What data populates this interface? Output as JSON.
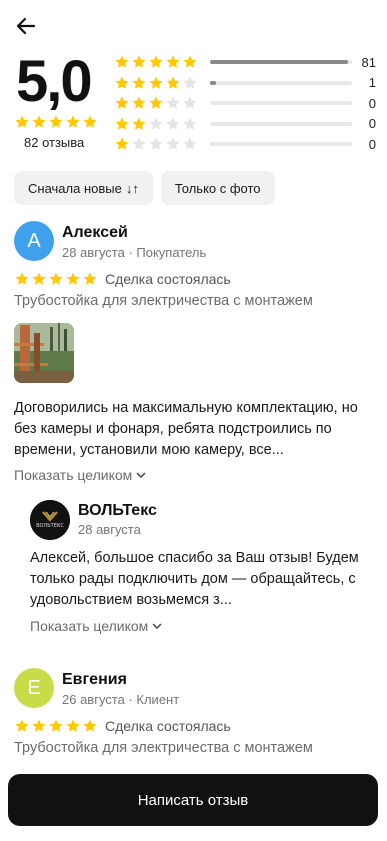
{
  "header": {
    "back_icon": "arrow-left-icon"
  },
  "summary": {
    "score": "5,0",
    "reviews_count": "82 отзыва",
    "average_rating": 5,
    "distribution": [
      {
        "stars": 5,
        "count": "81",
        "fraction": 0.97
      },
      {
        "stars": 4,
        "count": "1",
        "fraction": 0.04
      },
      {
        "stars": 3,
        "count": "0",
        "fraction": 0
      },
      {
        "stars": 2,
        "count": "0",
        "fraction": 0
      },
      {
        "stars": 1,
        "count": "0",
        "fraction": 0
      }
    ]
  },
  "filters": {
    "sort_label": "Сначала новые",
    "sort_icon": "↓↑",
    "photo_label": "Только с фото"
  },
  "reviews": [
    {
      "avatar_letter": "А",
      "avatar_color": "#3fa0ee",
      "name": "Алексей",
      "meta": "28 августа · Покупатель",
      "rating": 5,
      "deal_status": "Сделка состоялась",
      "product": "Трубостойка для электричества с монтажем",
      "text": "Договорились на максимальную комплектацию, но без камеры и фонаря, ребята подстроились по времени, установили мою камеру, все...",
      "show_more": "Показать целиком",
      "reply": {
        "name": "ВОЛЬТекс",
        "logo_text": "ВОЛЬТЕКС",
        "date": "28 августа",
        "text": "Алексей, большое спасибо за Ваш отзыв! Будем только рады подключить дом — обращайтесь, с удовольствием возьмемся з...",
        "show_more": "Показать целиком"
      }
    },
    {
      "avatar_letter": "Е",
      "avatar_color": "#c8dc4a",
      "name": "Евгения",
      "meta": "26 августа · Клиент",
      "rating": 5,
      "deal_status": "Сделка состоялась",
      "product": "Трубостойка для электричества с монтажем"
    }
  ],
  "footer": {
    "write_review": "Написать отзыв"
  },
  "colors": {
    "star_filled": "#ffc800",
    "star_empty": "#e4e4e4",
    "button_bg": "#111111"
  }
}
